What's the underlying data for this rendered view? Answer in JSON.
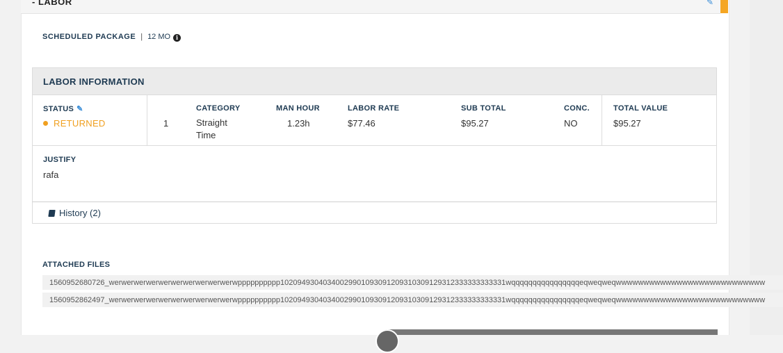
{
  "section": {
    "title": "- LABOR"
  },
  "scheduled_package": {
    "label": "SCHEDULED PACKAGE",
    "separator": "|",
    "value": "12 MO"
  },
  "labor_info": {
    "title": "LABOR INFORMATION",
    "status_label": "STATUS",
    "status_value": "RETURNED",
    "index": "1",
    "columns": {
      "category": "CATEGORY",
      "man_hour": "MAN HOUR",
      "labor_rate": "LABOR RATE",
      "sub_total": "SUB TOTAL",
      "conc": "CONC.",
      "total_value": "TOTAL VALUE"
    },
    "values": {
      "category_line1": "Straight",
      "category_line2": "Time",
      "man_hour": "1.23h",
      "labor_rate": "$77.46",
      "sub_total": "$95.27",
      "conc": "NO",
      "total_value": "$95.27"
    },
    "justify_label": "JUSTIFY",
    "justify_value": "rafa"
  },
  "history": {
    "label": "History (2)"
  },
  "attached_files": {
    "title": "ATTACHED FILES",
    "files": [
      "1560952680726_werwerwerwerwerwerwerwerwerwerwpppppppppp10209493040340029901093091209310309129312333333333331wqqqqqqqqqqqqqqqqeqweqweqwwwwwwwwwwwwwwwwwwwwwwwwwww",
      "1560952862497_werwerwerwerwerwerwerwerwerwerwpppppppppp10209493040340029901093091209310309129312333333333331wqqqqqqqqqqqqqqqqeqweqweqwwwwwwwwwwwwwwwwwwwwwwwwwww"
    ]
  },
  "icons": {
    "edit": "pencil-icon",
    "info": "info-circle-icon",
    "history": "book-icon"
  },
  "colors": {
    "accent": "#f5a623",
    "status_returned": "#f0a020",
    "link_blue": "#3a8ed8",
    "heading": "#1e3a52"
  }
}
